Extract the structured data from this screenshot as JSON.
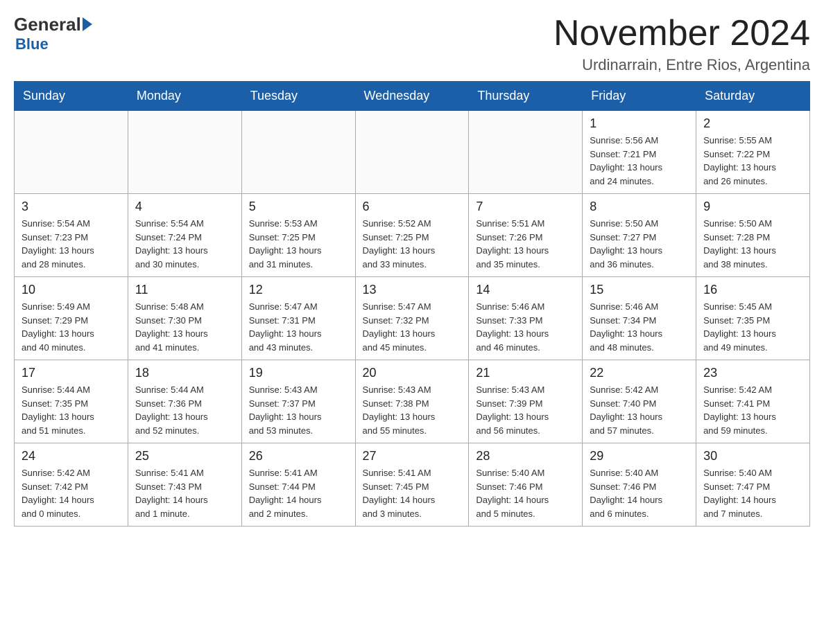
{
  "logo": {
    "general": "General",
    "blue": "Blue"
  },
  "header": {
    "title": "November 2024",
    "location": "Urdinarrain, Entre Rios, Argentina"
  },
  "days_of_week": [
    "Sunday",
    "Monday",
    "Tuesday",
    "Wednesday",
    "Thursday",
    "Friday",
    "Saturday"
  ],
  "weeks": [
    {
      "days": [
        {
          "date": "",
          "info": ""
        },
        {
          "date": "",
          "info": ""
        },
        {
          "date": "",
          "info": ""
        },
        {
          "date": "",
          "info": ""
        },
        {
          "date": "",
          "info": ""
        },
        {
          "date": "1",
          "info": "Sunrise: 5:56 AM\nSunset: 7:21 PM\nDaylight: 13 hours\nand 24 minutes."
        },
        {
          "date": "2",
          "info": "Sunrise: 5:55 AM\nSunset: 7:22 PM\nDaylight: 13 hours\nand 26 minutes."
        }
      ]
    },
    {
      "days": [
        {
          "date": "3",
          "info": "Sunrise: 5:54 AM\nSunset: 7:23 PM\nDaylight: 13 hours\nand 28 minutes."
        },
        {
          "date": "4",
          "info": "Sunrise: 5:54 AM\nSunset: 7:24 PM\nDaylight: 13 hours\nand 30 minutes."
        },
        {
          "date": "5",
          "info": "Sunrise: 5:53 AM\nSunset: 7:25 PM\nDaylight: 13 hours\nand 31 minutes."
        },
        {
          "date": "6",
          "info": "Sunrise: 5:52 AM\nSunset: 7:25 PM\nDaylight: 13 hours\nand 33 minutes."
        },
        {
          "date": "7",
          "info": "Sunrise: 5:51 AM\nSunset: 7:26 PM\nDaylight: 13 hours\nand 35 minutes."
        },
        {
          "date": "8",
          "info": "Sunrise: 5:50 AM\nSunset: 7:27 PM\nDaylight: 13 hours\nand 36 minutes."
        },
        {
          "date": "9",
          "info": "Sunrise: 5:50 AM\nSunset: 7:28 PM\nDaylight: 13 hours\nand 38 minutes."
        }
      ]
    },
    {
      "days": [
        {
          "date": "10",
          "info": "Sunrise: 5:49 AM\nSunset: 7:29 PM\nDaylight: 13 hours\nand 40 minutes."
        },
        {
          "date": "11",
          "info": "Sunrise: 5:48 AM\nSunset: 7:30 PM\nDaylight: 13 hours\nand 41 minutes."
        },
        {
          "date": "12",
          "info": "Sunrise: 5:47 AM\nSunset: 7:31 PM\nDaylight: 13 hours\nand 43 minutes."
        },
        {
          "date": "13",
          "info": "Sunrise: 5:47 AM\nSunset: 7:32 PM\nDaylight: 13 hours\nand 45 minutes."
        },
        {
          "date": "14",
          "info": "Sunrise: 5:46 AM\nSunset: 7:33 PM\nDaylight: 13 hours\nand 46 minutes."
        },
        {
          "date": "15",
          "info": "Sunrise: 5:46 AM\nSunset: 7:34 PM\nDaylight: 13 hours\nand 48 minutes."
        },
        {
          "date": "16",
          "info": "Sunrise: 5:45 AM\nSunset: 7:35 PM\nDaylight: 13 hours\nand 49 minutes."
        }
      ]
    },
    {
      "days": [
        {
          "date": "17",
          "info": "Sunrise: 5:44 AM\nSunset: 7:35 PM\nDaylight: 13 hours\nand 51 minutes."
        },
        {
          "date": "18",
          "info": "Sunrise: 5:44 AM\nSunset: 7:36 PM\nDaylight: 13 hours\nand 52 minutes."
        },
        {
          "date": "19",
          "info": "Sunrise: 5:43 AM\nSunset: 7:37 PM\nDaylight: 13 hours\nand 53 minutes."
        },
        {
          "date": "20",
          "info": "Sunrise: 5:43 AM\nSunset: 7:38 PM\nDaylight: 13 hours\nand 55 minutes."
        },
        {
          "date": "21",
          "info": "Sunrise: 5:43 AM\nSunset: 7:39 PM\nDaylight: 13 hours\nand 56 minutes."
        },
        {
          "date": "22",
          "info": "Sunrise: 5:42 AM\nSunset: 7:40 PM\nDaylight: 13 hours\nand 57 minutes."
        },
        {
          "date": "23",
          "info": "Sunrise: 5:42 AM\nSunset: 7:41 PM\nDaylight: 13 hours\nand 59 minutes."
        }
      ]
    },
    {
      "days": [
        {
          "date": "24",
          "info": "Sunrise: 5:42 AM\nSunset: 7:42 PM\nDaylight: 14 hours\nand 0 minutes."
        },
        {
          "date": "25",
          "info": "Sunrise: 5:41 AM\nSunset: 7:43 PM\nDaylight: 14 hours\nand 1 minute."
        },
        {
          "date": "26",
          "info": "Sunrise: 5:41 AM\nSunset: 7:44 PM\nDaylight: 14 hours\nand 2 minutes."
        },
        {
          "date": "27",
          "info": "Sunrise: 5:41 AM\nSunset: 7:45 PM\nDaylight: 14 hours\nand 3 minutes."
        },
        {
          "date": "28",
          "info": "Sunrise: 5:40 AM\nSunset: 7:46 PM\nDaylight: 14 hours\nand 5 minutes."
        },
        {
          "date": "29",
          "info": "Sunrise: 5:40 AM\nSunset: 7:46 PM\nDaylight: 14 hours\nand 6 minutes."
        },
        {
          "date": "30",
          "info": "Sunrise: 5:40 AM\nSunset: 7:47 PM\nDaylight: 14 hours\nand 7 minutes."
        }
      ]
    }
  ]
}
